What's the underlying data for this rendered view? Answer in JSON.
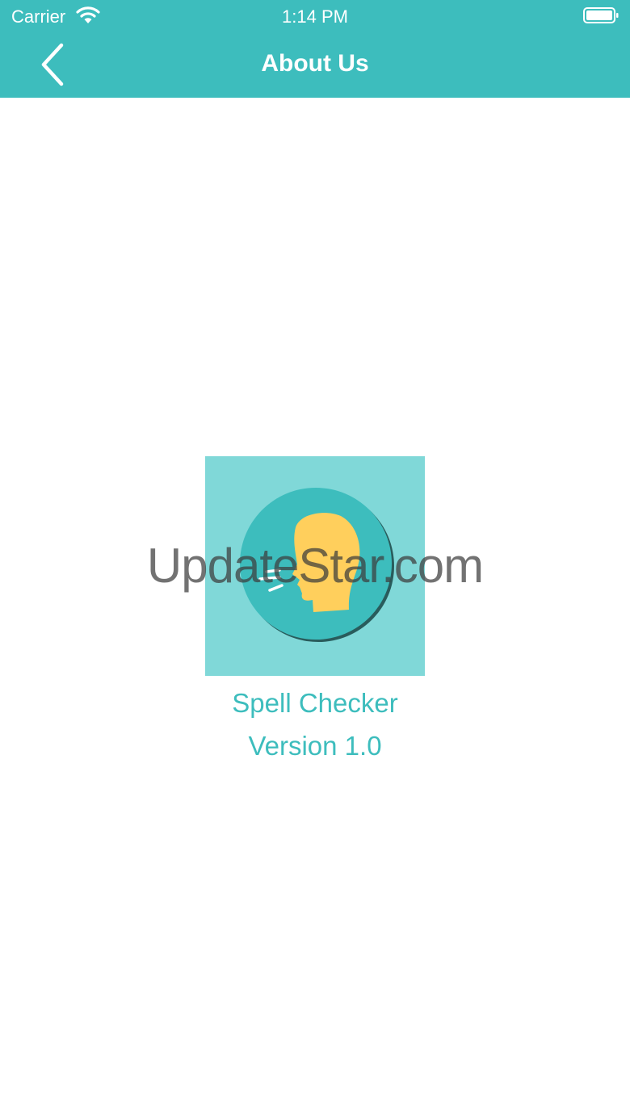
{
  "status_bar": {
    "carrier": "Carrier",
    "time": "1:14 PM",
    "wifi_icon": "wifi-icon",
    "battery_icon": "battery-icon"
  },
  "nav": {
    "title": "About Us",
    "back_icon": "chevron-left-icon"
  },
  "content": {
    "app_name": "Spell Checker",
    "version": "Version 1.0",
    "app_icon": "speaking-head-icon",
    "watermark": "UpdateStar.com"
  },
  "colors": {
    "accent": "#3dbdbd",
    "icon_background": "#80d8d8",
    "icon_face": "#ffcf5c",
    "background": "#ffffff"
  }
}
